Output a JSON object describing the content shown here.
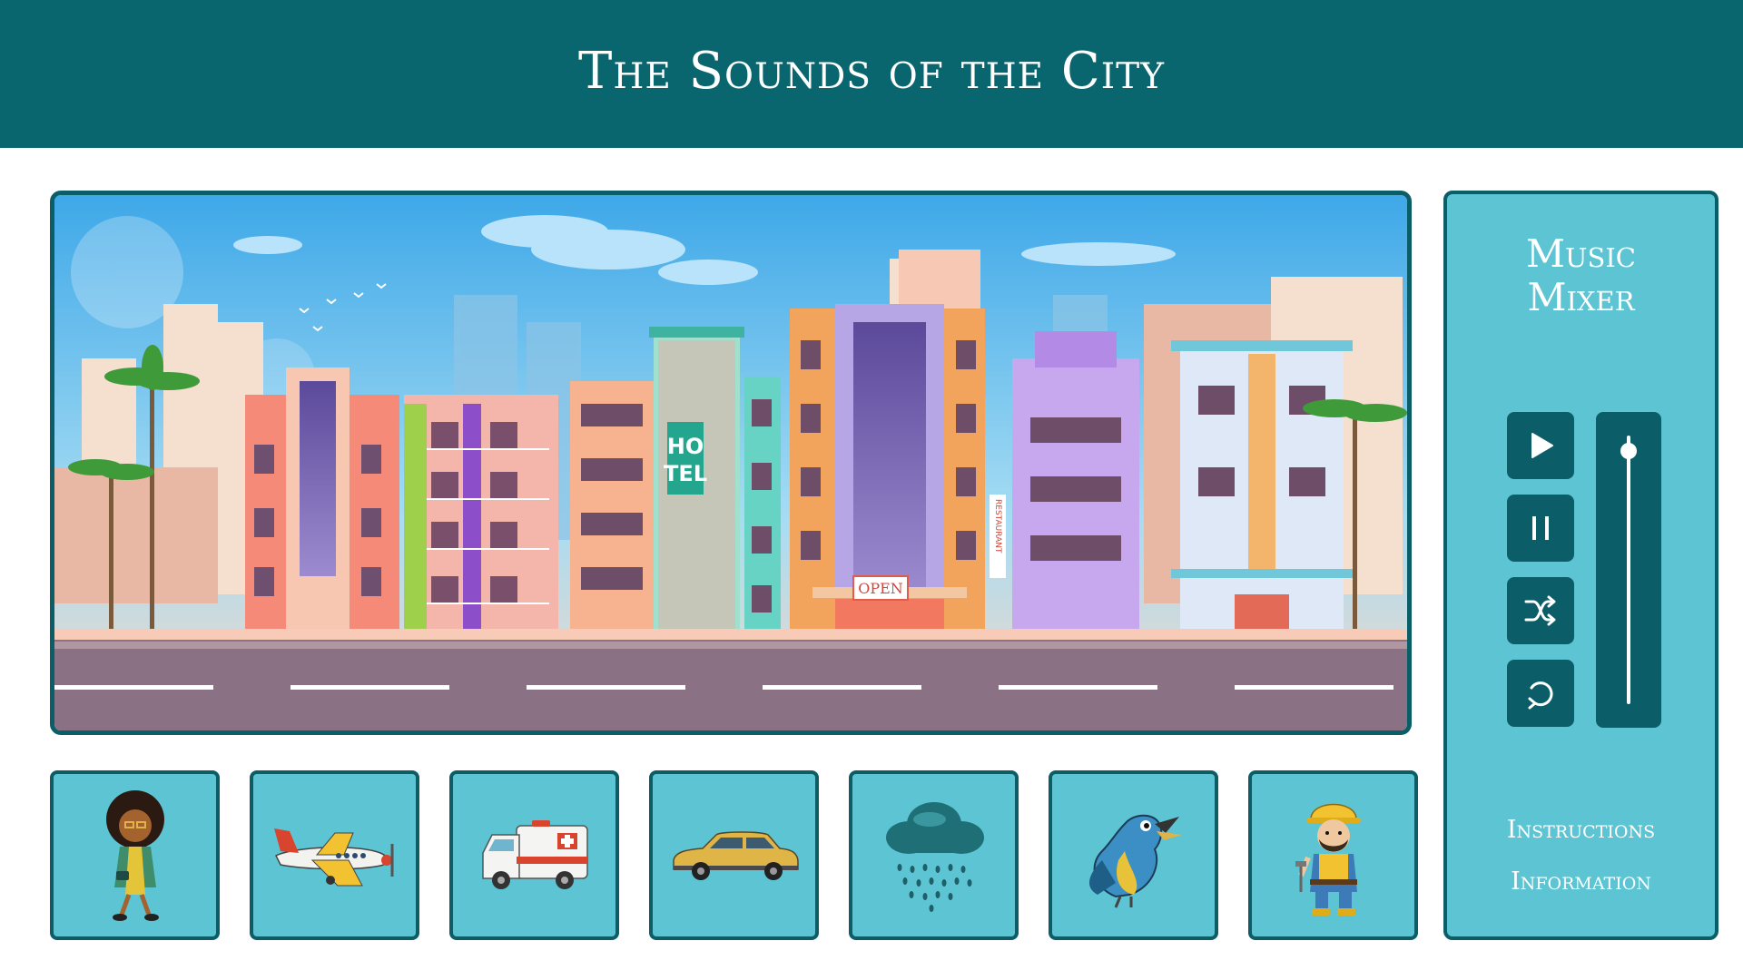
{
  "header": {
    "title": "The Sounds of the City"
  },
  "scene": {
    "hotel_sign": [
      "HO",
      "TEL"
    ],
    "open_sign": "OPEN",
    "restaurant_sign": "RESTAURANT"
  },
  "tiles": [
    {
      "icon": "woman-walking-icon"
    },
    {
      "icon": "airplane-icon"
    },
    {
      "icon": "ambulance-icon"
    },
    {
      "icon": "taxi-car-icon"
    },
    {
      "icon": "rain-cloud-icon"
    },
    {
      "icon": "bird-icon"
    },
    {
      "icon": "construction-worker-icon"
    }
  ],
  "mixer": {
    "title_line1": "Music",
    "title_line2": "Mixer",
    "controls": [
      "play-icon",
      "pause-icon",
      "shuffle-icon",
      "repeat-icon"
    ],
    "volume": 0.97,
    "instructions_label": "Instructions",
    "information_label": "Information"
  },
  "colors": {
    "header": "#09666f",
    "panel": "#5cc4d2",
    "dark": "#0b5e68",
    "text": "#ffffff"
  }
}
